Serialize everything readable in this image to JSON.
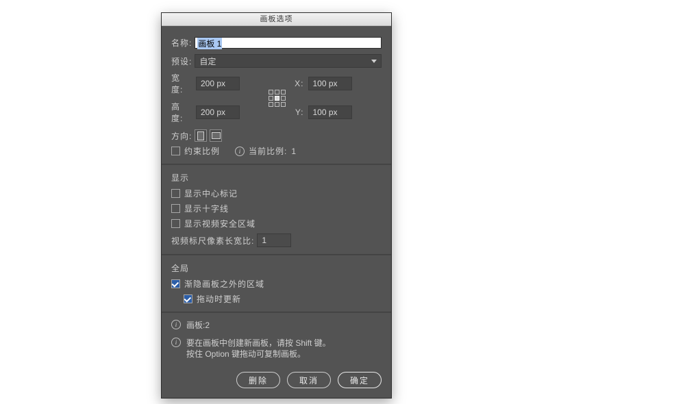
{
  "title": "画板选项",
  "name": {
    "label": "名称:",
    "value": "画板 1"
  },
  "preset": {
    "label": "预设:",
    "value": "自定"
  },
  "size": {
    "width": {
      "label": "宽度:",
      "value": "200 px"
    },
    "height": {
      "label": "高度:",
      "value": "200 px"
    },
    "x": {
      "label": "X:",
      "value": "100 px"
    },
    "y": {
      "label": "Y:",
      "value": "100 px"
    }
  },
  "orientation": {
    "label": "方向:"
  },
  "constrain": {
    "label": "约束比例",
    "infoLabel": "当前比例:",
    "infoValue": "1"
  },
  "display": {
    "section": "显示",
    "centerMark": "显示中心标记",
    "cross": "显示十字线",
    "safe": "显示视频安全区域",
    "pixelAspect": {
      "label": "视频标尺像素长宽比:",
      "value": "1"
    }
  },
  "global": {
    "section": "全局",
    "fade": "渐隐画板之外的区域",
    "dragUpdate": "拖动时更新"
  },
  "footerInfo": {
    "count": {
      "label": "画板:",
      "value": "2"
    },
    "hint": "要在画板中创建新画板，请按 Shift 键。\n按住 Option 键拖动可复制画板。"
  },
  "buttons": {
    "delete": "删除",
    "cancel": "取消",
    "ok": "确定"
  }
}
